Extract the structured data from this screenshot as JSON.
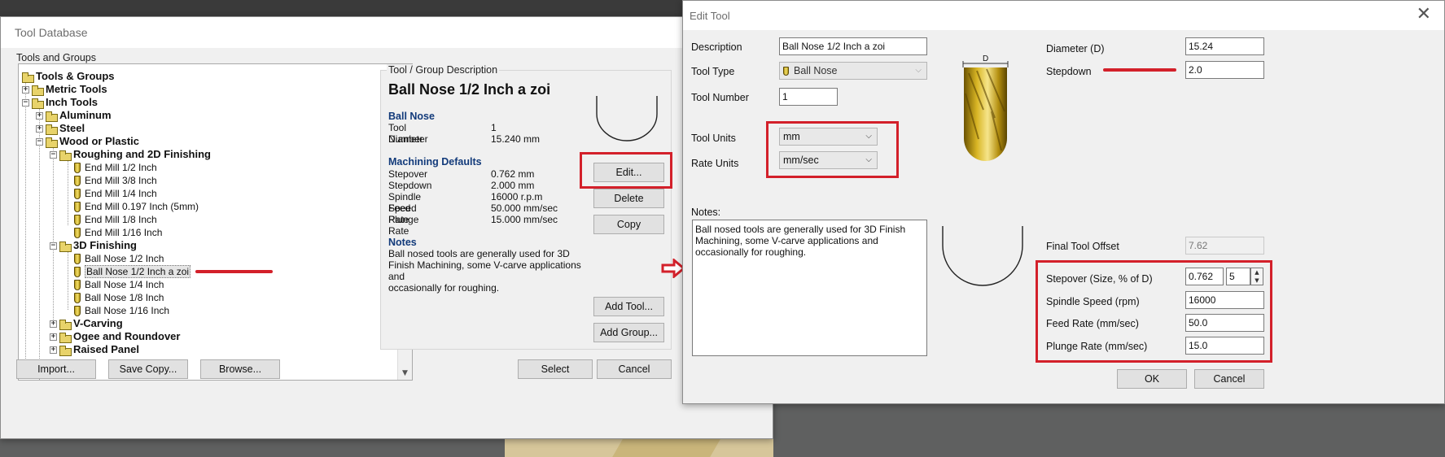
{
  "colors": {
    "highlight_red": "#d3202a",
    "heading_blue": "#123a7a",
    "window_bg": "#f0f0f0"
  },
  "tool_database": {
    "title": "Tool Database",
    "close_icon": "close-icon",
    "tools_and_groups_label": "Tools and Groups",
    "tree": {
      "root": "Tools & Groups",
      "metric": "Metric Tools",
      "inch": "Inch Tools",
      "aluminum": "Aluminum",
      "steel": "Steel",
      "wood": "Wood or Plastic",
      "roughing": "Roughing and 2D Finishing",
      "roughing_items": [
        "End Mill 1/2 Inch",
        "End Mill 3/8 Inch",
        "End Mill 1/4 Inch",
        "End Mill 0.197 Inch (5mm)",
        "End Mill 1/8 Inch",
        "End Mill 1/16 Inch"
      ],
      "finishing": "3D Finishing",
      "finishing_items": [
        "Ball Nose 1/2 Inch",
        "Ball Nose 1/2 Inch a zoi",
        "Ball Nose 1/4 Inch",
        "Ball Nose 1/8 Inch",
        "Ball Nose 1/16 Inch"
      ],
      "vcarving": "V-Carving",
      "ogee": "Ogee and Roundover",
      "raised": "Raised Panel"
    },
    "description": {
      "group_label": "Tool / Group Description",
      "tool_name": "Ball Nose 1/2 Inch a zoi",
      "type_heading": "Ball Nose",
      "tool_number_label": "Tool Number",
      "tool_number_value": "1",
      "diameter_label": "Diameter",
      "diameter_value": "15.240 mm",
      "machining_heading": "Machining Defaults",
      "stepover_label": "Stepover",
      "stepover_value": "0.762 mm",
      "stepdown_label": "Stepdown",
      "stepdown_value": "2.000 mm",
      "spindle_label": "Spindle Speed",
      "spindle_value": "16000 r.p.m",
      "feed_label": "Feed Rate",
      "feed_value": "50.000 mm/sec",
      "plunge_label": "Plunge Rate",
      "plunge_value": "15.000 mm/sec",
      "notes_heading": "Notes",
      "notes_line1": "Ball nosed tools are generally used for 3D",
      "notes_line2": "Finish Machining, some V-carve applications",
      "notes_line3": "and",
      "notes_line4": "occasionally for roughing."
    },
    "buttons": {
      "edit": "Edit...",
      "delete": "Delete",
      "copy": "Copy",
      "add_tool": "Add Tool...",
      "add_group": "Add Group...",
      "import": "Import...",
      "save_copy": "Save Copy...",
      "browse": "Browse...",
      "select": "Select",
      "cancel": "Cancel"
    }
  },
  "edit_tool": {
    "title": "Edit Tool",
    "description_label": "Description",
    "description_value": "Ball Nose 1/2 Inch a zoi",
    "tool_type_label": "Tool Type",
    "tool_type_value": "Ball Nose",
    "tool_number_label": "Tool Number",
    "tool_number_value": "1",
    "tool_units_label": "Tool Units",
    "tool_units_value": "mm",
    "rate_units_label": "Rate Units",
    "rate_units_value": "mm/sec",
    "notes_label": "Notes:",
    "notes_line1": "Ball nosed tools are generally used for 3D Finish",
    "notes_line2": "Machining, some V-carve applications and",
    "notes_line3": "occasionally for roughing.",
    "tool_image_label": "D",
    "diameter_label": "Diameter (D)",
    "diameter_value": "15.24",
    "stepdown_label": "Stepdown",
    "stepdown_value": "2.0",
    "final_offset_label": "Final Tool Offset",
    "final_offset_value": "7.62",
    "stepover_label": "Stepover (Size, % of D)",
    "stepover_value": "0.762",
    "stepover_percent": "5",
    "spindle_label": "Spindle Speed (rpm)",
    "spindle_value": "16000",
    "feed_label": "Feed Rate (mm/sec)",
    "feed_value": "50.0",
    "plunge_label": "Plunge Rate (mm/sec)",
    "plunge_value": "15.0",
    "ok": "OK",
    "cancel": "Cancel"
  }
}
